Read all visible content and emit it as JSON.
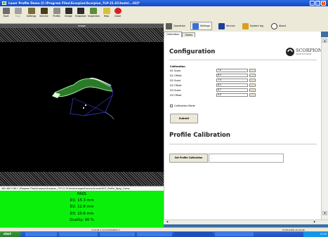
{
  "window": {
    "title": "Laser Profile Demo [C:\\Program Files\\Scorpion\\Scorpion_7LP-21.01\\tests\\...03]*",
    "buttons": [
      "_",
      "□",
      "×"
    ]
  },
  "toolbar": {
    "items": [
      {
        "label": "Start",
        "icon": "start-icon",
        "color": "#6d6d6d"
      },
      {
        "label": "Stop",
        "icon": "stop-icon",
        "color": "#a0a0a0"
      },
      {
        "label": "Settings",
        "icon": "settings-icon",
        "color": "#7a6b3a"
      },
      {
        "label": "Service",
        "icon": "service-icon",
        "color": "#4b3b1a"
      },
      {
        "label": "Profile",
        "icon": "profile-icon",
        "color": "#8d8d8d"
      },
      {
        "label": "Image",
        "icon": "image-icon",
        "color": "#2d2d2d"
      },
      {
        "label": "Snapshot",
        "icon": "snapshot-icon",
        "color": "#2b2b2b"
      },
      {
        "label": "Inspection",
        "icon": "inspection-icon",
        "color": "#5a8d3a"
      },
      {
        "label": "Help",
        "icon": "help-icon",
        "color": "#d8c13a"
      },
      {
        "label": "Close",
        "icon": "close-icon",
        "color": "#d6201c"
      }
    ]
  },
  "image_panel": {
    "title": "Image",
    "status_line": "481:460 0.86   C:\\Program Files\\Scorpion\\Scorpion_7LP-21.01\\tests\\images\\Factory\\Scans\\0001_Profile_8peg_1.bmp"
  },
  "result": {
    "status": "PASS",
    "d1": "D1:  15.3 mm",
    "d2": "D2:  12.8 mm",
    "d3": "D3:  10.6 mm",
    "quality": "Quality:  90 %"
  },
  "right_toolbar": {
    "items": [
      {
        "label": "Operation",
        "icon": "operation-icon",
        "color": "#5f5f5f"
      },
      {
        "label": "Settings",
        "icon": "settings-icon",
        "color": "#3a6ed5"
      },
      {
        "label": "Service",
        "icon": "service-icon",
        "color": "#1a3f99"
      },
      {
        "label": "System log",
        "icon": "system-log-icon",
        "color": "#d9a020"
      },
      {
        "label": "About",
        "icon": "about-icon",
        "color": "#333333"
      }
    ]
  },
  "tabs": [
    "Calibration",
    "States"
  ],
  "configuration": {
    "heading": "Configuration",
    "logo_text": "SCORPION",
    "logo_sub": "VISION SOFTWARE",
    "calibration_label": "Calibration",
    "fields": [
      {
        "label": "D1 Scale",
        "value": "7.0"
      },
      {
        "label": "D1 Offset",
        "value": "8.5"
      },
      {
        "label": "D2 Scale",
        "value": "7.0"
      },
      {
        "label": "D2 Offset",
        "value": "8.2"
      },
      {
        "label": "D3 Scale",
        "value": "8.7"
      },
      {
        "label": "D3 Offset",
        "value": "0.0"
      }
    ],
    "field_button": "...",
    "calibration_mode": "Calibration Mode",
    "submit": "Submit"
  },
  "profile_calibration": {
    "heading": "Profile Calibration",
    "button": "Set Profile Calibration",
    "value": "-"
  },
  "footer": {
    "center": "3.10.34 1.11.9  Protraktor 1",
    "right": "07/01/2009  15:29:06"
  },
  "taskbar": {
    "start": "start",
    "tasks": [
      "",
      "",
      "",
      "",
      "",
      ""
    ],
    "clock": "15:29"
  },
  "colors": {
    "result_bg": "#0af00a",
    "title_blue": "#1f52cf"
  }
}
